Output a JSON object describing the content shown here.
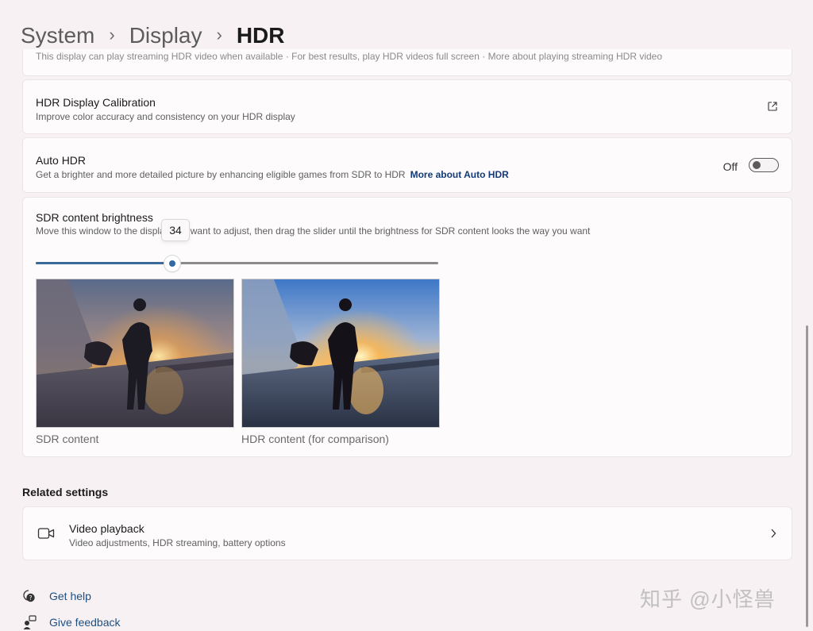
{
  "breadcrumb": {
    "items": [
      "System",
      "Display"
    ],
    "current": "HDR",
    "separator": "›"
  },
  "top_partial": {
    "text": "This display can play streaming HDR video when available · For best results, play HDR videos full screen · More about playing streaming HDR video"
  },
  "calibration": {
    "title": "HDR Display Calibration",
    "description": "Improve color accuracy and consistency on your HDR display",
    "icon": "external-link-icon"
  },
  "auto_hdr": {
    "title": "Auto HDR",
    "description": "Get a brighter and more detailed picture by enhancing eligible games from SDR to HDR",
    "link": "More about Auto HDR",
    "toggle_state": "Off"
  },
  "sdr_brightness": {
    "title": "SDR content brightness",
    "description": "Move this window to the display you want to adjust, then drag the slider until the brightness for SDR content looks the way you want",
    "value": 34,
    "value_label": "34",
    "sdr_caption": "SDR content",
    "hdr_caption": "HDR content (for comparison)"
  },
  "related": {
    "title": "Related settings",
    "video": {
      "title": "Video playback",
      "description": "Video adjustments, HDR streaming, battery options",
      "icon": "video-camera-icon"
    }
  },
  "footer": {
    "help": "Get help",
    "feedback": "Give feedback"
  },
  "watermark": "知乎 @小怪兽",
  "colors": {
    "accent": "#2f6aa3",
    "link": "#123a7a",
    "background": "#f7f1f4",
    "card": "#fdfbfc"
  }
}
